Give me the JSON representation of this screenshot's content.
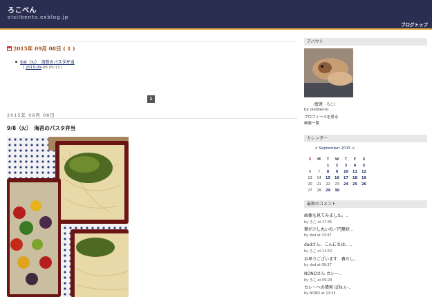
{
  "header": {
    "title": "ろこべん",
    "url": "oisiibento.exblog.jp",
    "blog_top": "ブログトップ"
  },
  "archive": {
    "heading": "2015年 09月 08日 ( 1 )",
    "items": [
      {
        "title": "9/8（火）　海苔のパスタ弁当",
        "date_link": "2015-09",
        "date_rest": "-08 09:13"
      }
    ],
    "page": "1"
  },
  "post": {
    "date": "2015年 09月 08日",
    "title": "9/8（火）　海苔のパスタ弁当"
  },
  "sidebar": {
    "about_title": "アバウト",
    "admin_label": "（管理　ろこ）",
    "by": "by oisiibento",
    "profile_link": "プロフィールを見る",
    "images_link": "画像一覧",
    "calendar_title": "カレンダー",
    "calendar_nav": "< September 2015 >",
    "calendar_weekdays": [
      "S",
      "M",
      "T",
      "W",
      "T",
      "F",
      "S"
    ],
    "calendar_weeks": [
      [
        "",
        "",
        "1",
        "2",
        "3",
        "4",
        "5"
      ],
      [
        "6",
        "7",
        "8",
        "9",
        "10",
        "11",
        "12"
      ],
      [
        "13",
        "14",
        "15",
        "16",
        "17",
        "18",
        "19"
      ],
      [
        "20",
        "21",
        "22",
        "23",
        "24",
        "25",
        "26"
      ],
      [
        "27",
        "28",
        "29",
        "30",
        "",
        "",
        ""
      ]
    ],
    "calendar_bold_days": [
      "1",
      "2",
      "3",
      "4",
      "5",
      "8",
      "9",
      "10",
      "11",
      "12",
      "15",
      "16",
      "17",
      "18",
      "19",
      "24",
      "25",
      "26",
      "29",
      "30"
    ],
    "comments_title": "最新のコメント",
    "comments": [
      {
        "text": "画像も見てみました。..",
        "by": "by ろこ at 17:35"
      },
      {
        "text": "葉が少し丸いの／円葉状 ..",
        "by": "by dad at 13:47"
      },
      {
        "text": "dadさん、こんにちは。..",
        "by": "by ろこ at 11:52"
      },
      {
        "text": "お早うございます　春らし..",
        "by": "by dad at 09:37"
      },
      {
        "text": "NONOさん カレー..",
        "by": "by ろこ at 09:29"
      },
      {
        "text": "カレーへの情熱 ぱねぇ-..",
        "by": "by NONO at 23:55"
      }
    ]
  }
}
